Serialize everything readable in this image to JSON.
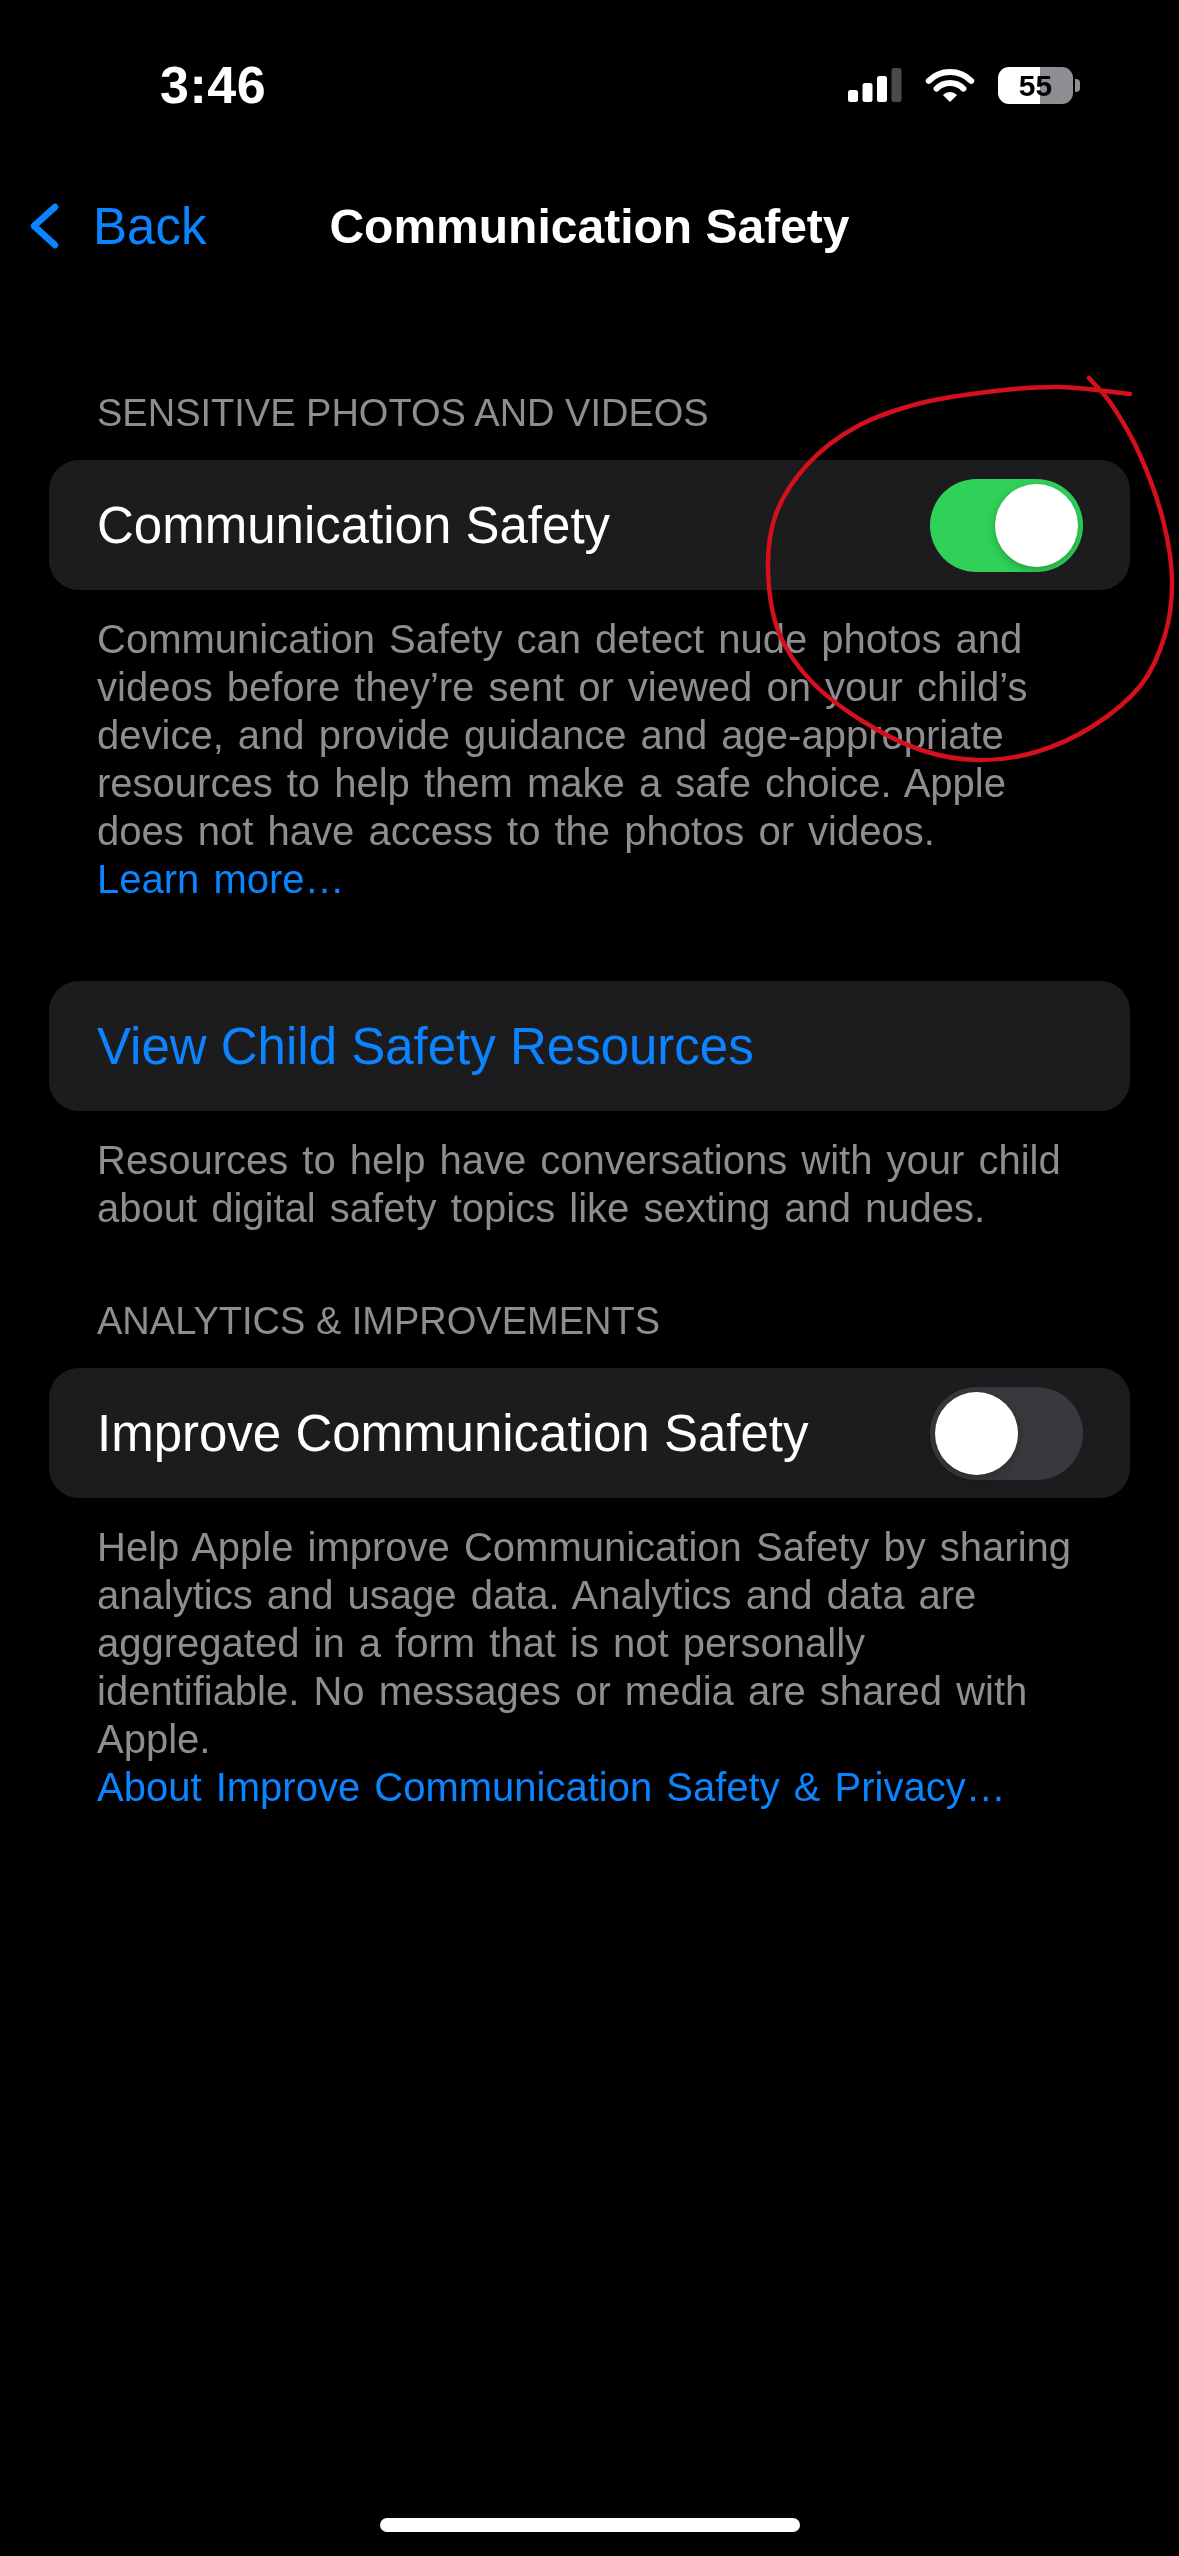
{
  "status_bar": {
    "time": "3:46",
    "battery": "55"
  },
  "nav_bar": {
    "back_label": "Back",
    "title": "Communication Safety"
  },
  "sections": [
    {
      "header": "SENSITIVE PHOTOS AND VIDEOS",
      "rows": [
        {
          "kind": "toggle",
          "label": "Communication Safety",
          "on": true
        }
      ],
      "footer": {
        "text": "Communication Safety can detect nude photos and videos before they’re sent or viewed on your child’s device, and provide guidance and age-appropriate resources to help them make a safe choice. Apple does not have access to the photos or videos.",
        "link": "Learn more…"
      }
    },
    {
      "rows": [
        {
          "kind": "link",
          "label": "View Child Safety Resources"
        }
      ],
      "footer": {
        "text": "Resources to help have conversations with your child about digital safety topics like sexting and nudes."
      }
    },
    {
      "header": "ANALYTICS & IMPROVEMENTS",
      "rows": [
        {
          "kind": "toggle",
          "label": "Improve Communication Safety",
          "on": false
        }
      ],
      "footer": {
        "text": "Help Apple improve Communication Safety by sharing analytics and usage data. Analytics and data are aggregated in a form that is not personally identifiable. No messages or media are shared with Apple.",
        "link": "About Improve Communication Safety & Privacy…"
      }
    }
  ],
  "annotations": [
    {
      "kind": "freehand_circle"
    }
  ]
}
